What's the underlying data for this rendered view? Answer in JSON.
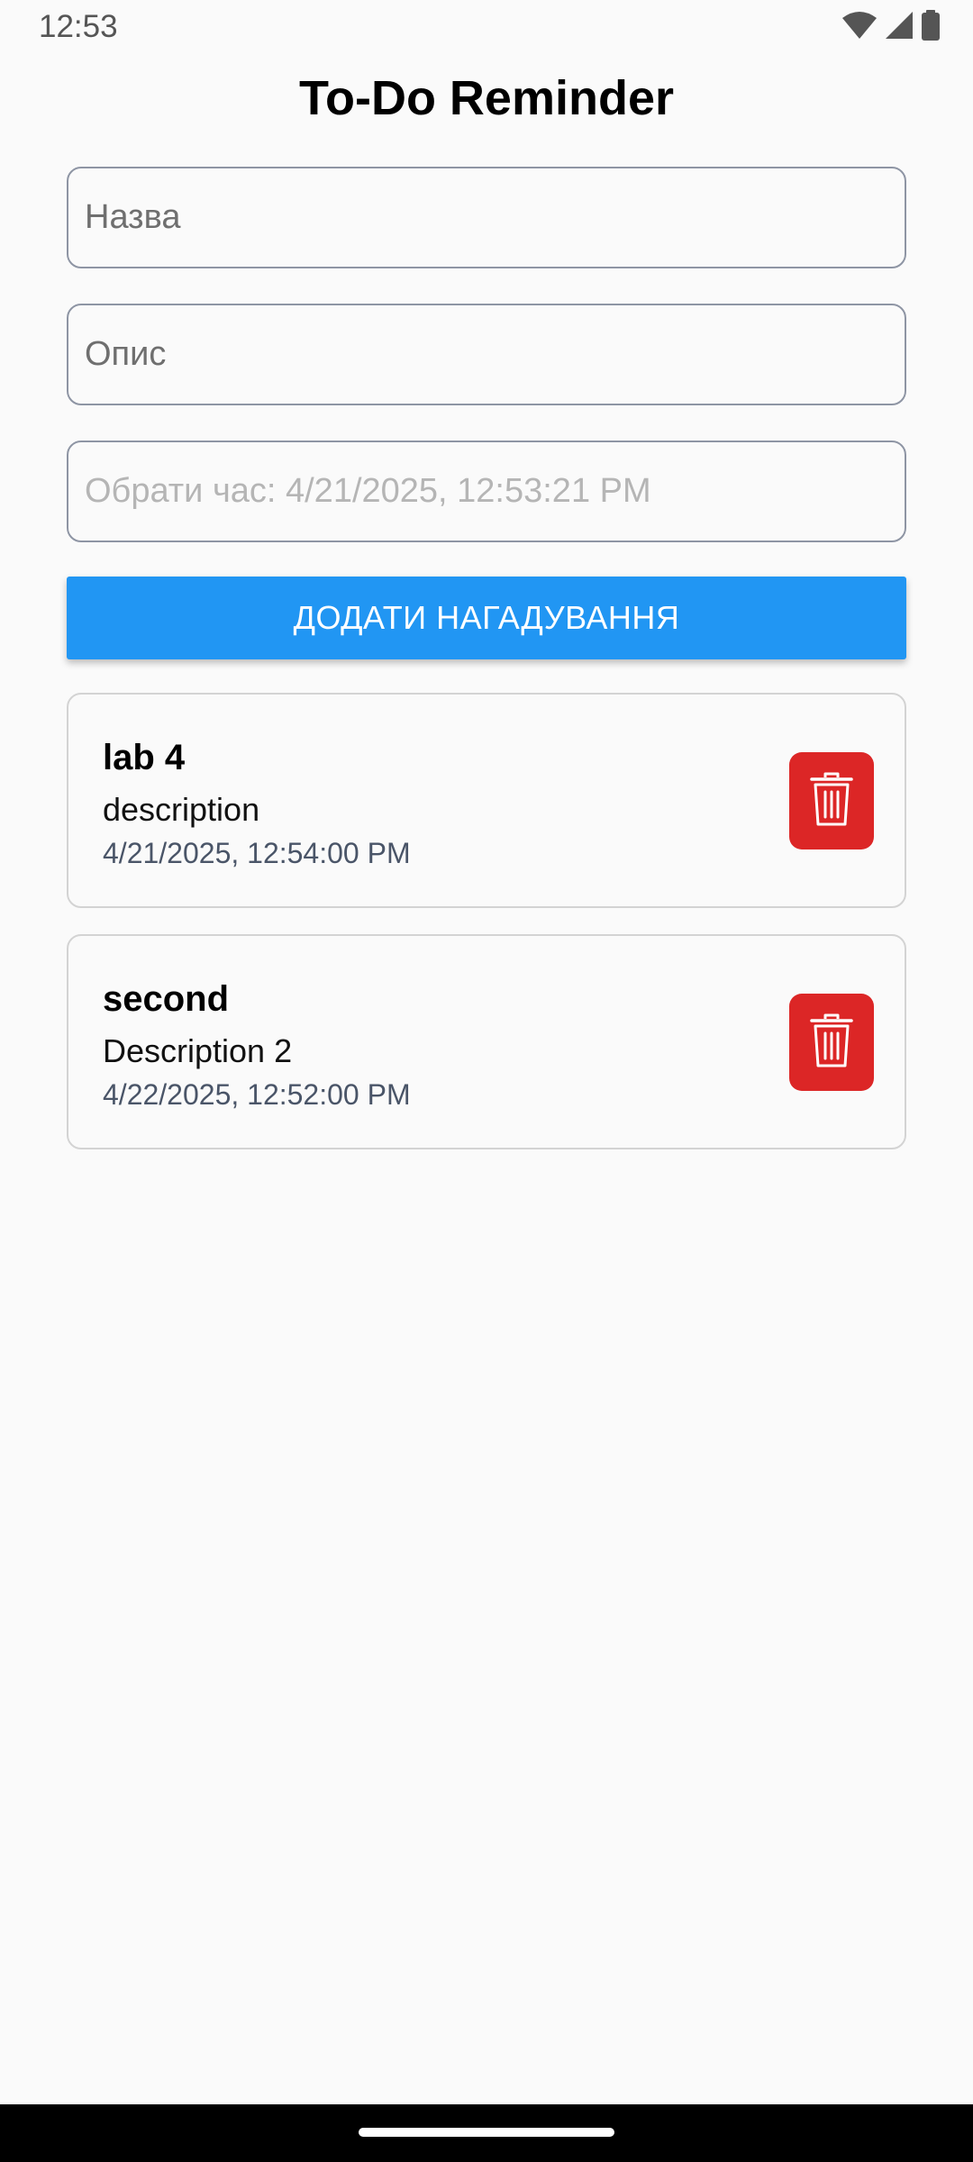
{
  "status_bar": {
    "time": "12:53",
    "icons": [
      "wifi-icon",
      "signal-icon",
      "battery-icon"
    ]
  },
  "app": {
    "title": "To-Do Reminder"
  },
  "form": {
    "title_placeholder": "Назва",
    "description_placeholder": "Опис",
    "time_placeholder": "Обрати час: 4/21/2025, 12:53:21 PM",
    "add_button_label": "ДОДАТИ НАГАДУВАННЯ"
  },
  "reminders": [
    {
      "title": "lab 4",
      "description": "description",
      "time": "4/21/2025, 12:54:00 PM"
    },
    {
      "title": "second",
      "description": "Description 2",
      "time": "4/22/2025, 12:52:00 PM"
    }
  ],
  "colors": {
    "accent": "#2196f3",
    "delete": "#dc2626",
    "background": "#fafafa"
  }
}
